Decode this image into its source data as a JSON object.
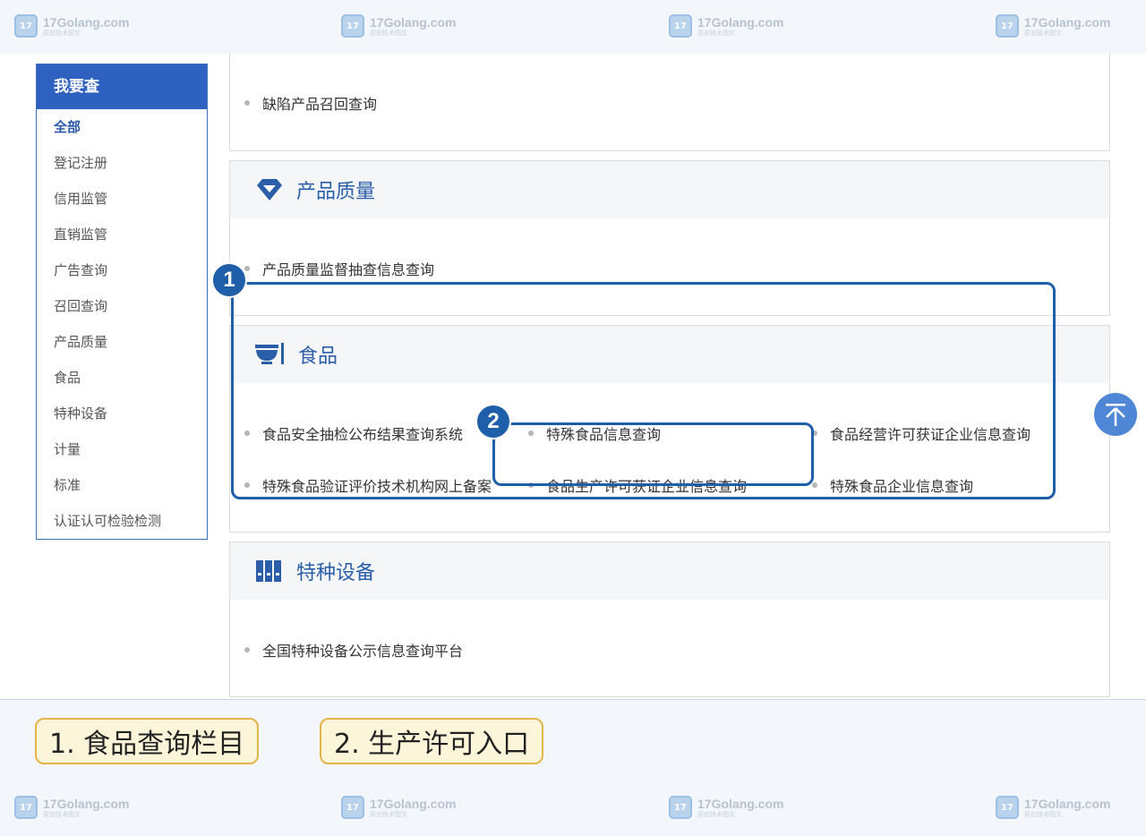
{
  "watermark": {
    "site": "17Golang.com",
    "sub": "原创技术图文",
    "logo_text": "17"
  },
  "sidebar": {
    "title": "我要查",
    "items": [
      {
        "label": "全部",
        "active": true
      },
      {
        "label": "登记注册"
      },
      {
        "label": "信用监管"
      },
      {
        "label": "直销监管"
      },
      {
        "label": "广告查询"
      },
      {
        "label": "召回查询"
      },
      {
        "label": "产品质量"
      },
      {
        "label": "食品"
      },
      {
        "label": "特种设备"
      },
      {
        "label": "计量"
      },
      {
        "label": "标准"
      },
      {
        "label": "认证认可检验检测"
      }
    ]
  },
  "recall_panel": {
    "links": [
      "缺陷产品召回查询"
    ]
  },
  "quality_panel": {
    "title": "产品质量",
    "icon": "diamond-icon",
    "links": [
      "产品质量监督抽查信息查询"
    ]
  },
  "food_panel": {
    "title": "食品",
    "icon": "bowl-icon",
    "links": [
      "食品安全抽检公布结果查询系统",
      "特殊食品信息查询",
      "食品经营许可获证企业信息查询",
      "特殊食品验证评价技术机构网上备案",
      "食品生产许可获证企业信息查询",
      "特殊食品企业信息查询"
    ]
  },
  "equipment_panel": {
    "title": "特种设备",
    "icon": "binder-icon",
    "links": [
      "全国特种设备公示信息查询平台"
    ]
  },
  "annotations": {
    "badge1": "1",
    "badge2": "2",
    "caption1": "1. 食品查询栏目",
    "caption2": "2. 生产许可入口"
  },
  "colors": {
    "accent": "#2f62c0",
    "annotation": "#1f5ea8",
    "caption_border": "#e2b44a"
  }
}
